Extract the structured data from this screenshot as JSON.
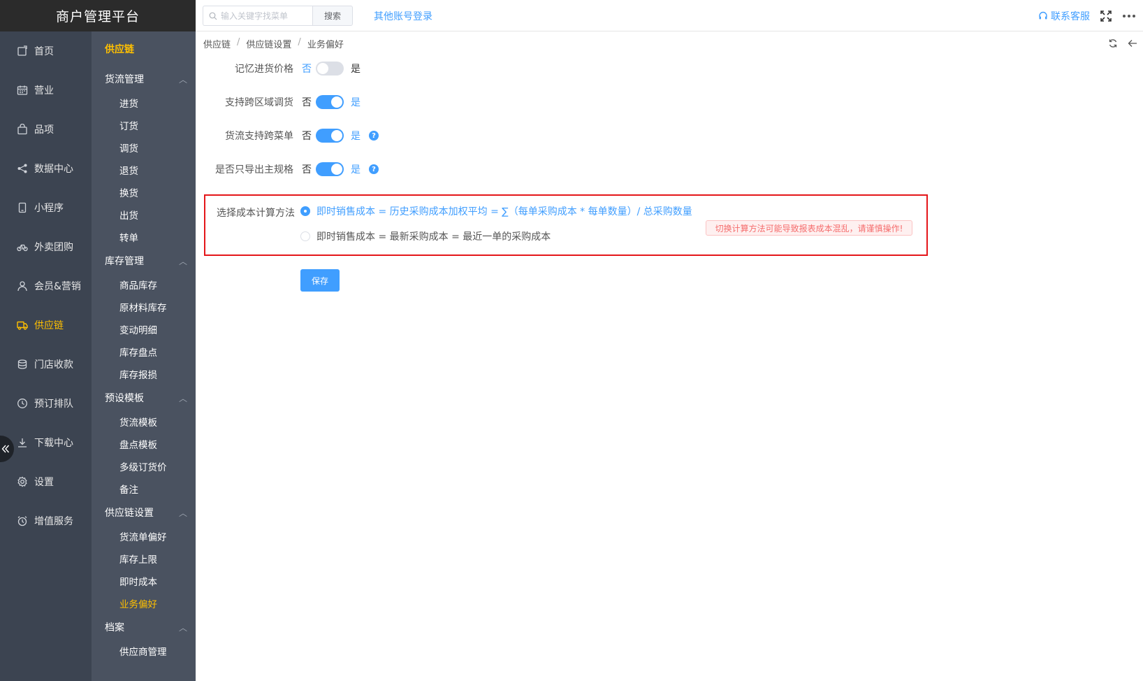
{
  "app": {
    "title": "商户管理平台"
  },
  "topbar": {
    "search_placeholder": "输入关键字找菜单",
    "search_button": "搜索",
    "other_login": "其他账号登录",
    "contact": "联系客服"
  },
  "sidebar": {
    "items": [
      {
        "label": "首页",
        "icon": "home-icon"
      },
      {
        "label": "营业",
        "icon": "calendar-icon"
      },
      {
        "label": "品项",
        "icon": "bag-icon"
      },
      {
        "label": "数据中心",
        "icon": "share-icon"
      },
      {
        "label": "小程序",
        "icon": "phone-icon"
      },
      {
        "label": "外卖团购",
        "icon": "bike-icon"
      },
      {
        "label": "会员&营销",
        "icon": "user-icon"
      },
      {
        "label": "供应链",
        "icon": "truck-icon",
        "active": true
      },
      {
        "label": "门店收款",
        "icon": "coins-icon"
      },
      {
        "label": "预订排队",
        "icon": "clock-icon"
      },
      {
        "label": "下载中心",
        "icon": "download-icon"
      },
      {
        "label": "设置",
        "icon": "gear-icon"
      },
      {
        "label": "增值服务",
        "icon": "alarm-icon"
      }
    ]
  },
  "subbar": {
    "title": "供应链",
    "groups": [
      {
        "label": "货流管理",
        "items": [
          "进货",
          "订货",
          "调货",
          "退货",
          "换货",
          "出货",
          "转单"
        ]
      },
      {
        "label": "库存管理",
        "items": [
          "商品库存",
          "原材料库存",
          "变动明细",
          "库存盘点",
          "库存报损"
        ]
      },
      {
        "label": "预设模板",
        "items": [
          "货流模板",
          "盘点模板",
          "多级订货价",
          "备注"
        ]
      },
      {
        "label": "供应链设置",
        "items": [
          "货流单偏好",
          "库存上限",
          "即时成本",
          "业务偏好"
        ]
      },
      {
        "label": "档案",
        "items": [
          "供应商管理"
        ]
      }
    ],
    "active_item": "业务偏好"
  },
  "breadcrumb": [
    "供应链",
    "供应链设置",
    "业务偏好"
  ],
  "form": {
    "no": "否",
    "yes": "是",
    "rows": [
      {
        "label": "记忆进货价格",
        "value": false,
        "help": false
      },
      {
        "label": "支持跨区域调货",
        "value": true,
        "help": false
      },
      {
        "label": "货流支持跨菜单",
        "value": true,
        "help": true
      },
      {
        "label": "是否只导出主规格",
        "value": true,
        "help": true
      }
    ],
    "cost_method": {
      "label": "选择成本计算方法",
      "options": [
        "即时销售成本 = 历史采购成本加权平均 = ∑（每单采购成本 * 每单数量）/ 总采购数量",
        "即时销售成本 = 最新采购成本 = 最近一单的采购成本"
      ],
      "selected": 0,
      "warning": "切换计算方法可能导致报表成本混乱，请谨慎操作!"
    },
    "save": "保存"
  },
  "colors": {
    "accent": "#409eff",
    "active_nav": "#ffc000",
    "sidebar": "#3c4451",
    "subbar": "#4a5260",
    "warning": "#f56c6c",
    "highlight_box": "#e4161a"
  }
}
